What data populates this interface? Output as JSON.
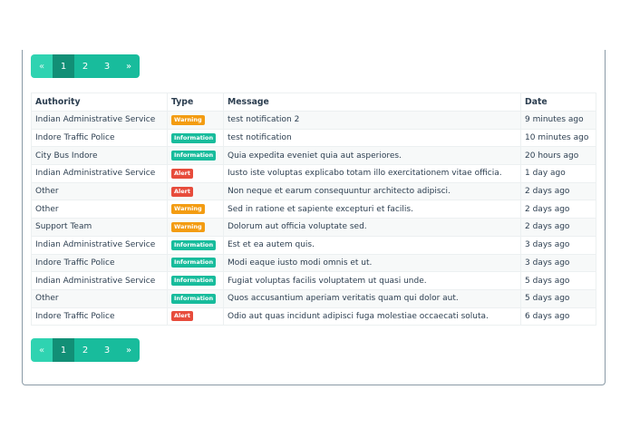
{
  "pagination": {
    "prev": "«",
    "pages": [
      "1",
      "2",
      "3"
    ],
    "next": "»",
    "current": "1"
  },
  "table": {
    "headers": [
      "Authority",
      "Type",
      "Message",
      "Date"
    ],
    "rows": [
      {
        "authority": "Indian Administrative Service",
        "type": "Warning",
        "message": "test notification 2",
        "date": "9 minutes ago"
      },
      {
        "authority": "Indore Traffic Police",
        "type": "Information",
        "message": "test notification",
        "date": "10 minutes ago"
      },
      {
        "authority": "City Bus Indore",
        "type": "Information",
        "message": "Quia expedita eveniet quia aut asperiores.",
        "date": "20 hours ago"
      },
      {
        "authority": "Indian Administrative Service",
        "type": "Alert",
        "message": "Iusto iste voluptas explicabo totam illo exercitationem vitae officia.",
        "date": "1 day ago"
      },
      {
        "authority": "Other",
        "type": "Alert",
        "message": "Non neque et earum consequuntur architecto adipisci.",
        "date": "2 days ago"
      },
      {
        "authority": "Other",
        "type": "Warning",
        "message": "Sed in ratione et sapiente excepturi et facilis.",
        "date": "2 days ago"
      },
      {
        "authority": "Support Team",
        "type": "Warning",
        "message": "Dolorum aut officia voluptate sed.",
        "date": "2 days ago"
      },
      {
        "authority": "Indian Administrative Service",
        "type": "Information",
        "message": "Est et ea autem quis.",
        "date": "3 days ago"
      },
      {
        "authority": "Indore Traffic Police",
        "type": "Information",
        "message": "Modi eaque iusto modi omnis et ut.",
        "date": "3 days ago"
      },
      {
        "authority": "Indian Administrative Service",
        "type": "Information",
        "message": "Fugiat voluptas facilis voluptatem ut quasi unde.",
        "date": "5 days ago"
      },
      {
        "authority": "Other",
        "type": "Information",
        "message": "Quos accusantium aperiam veritatis quam qui dolor aut.",
        "date": "5 days ago"
      },
      {
        "authority": "Indore Traffic Police",
        "type": "Alert",
        "message": "Odio aut quas incidunt adipisci fuga molestiae occaecati soluta.",
        "date": "6 days ago"
      }
    ]
  },
  "badge_colors": {
    "Warning": "#f39c12",
    "Information": "#18bc9c",
    "Alert": "#e74c3c"
  }
}
